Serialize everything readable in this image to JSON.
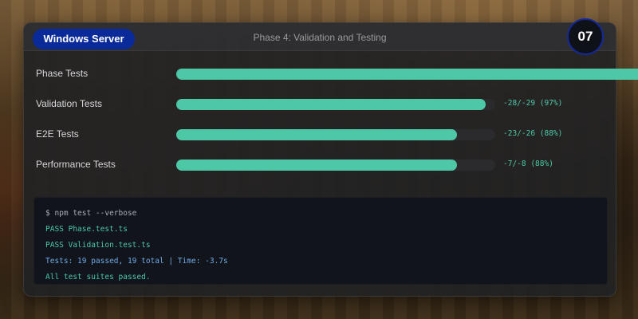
{
  "header": {
    "os_badge": "Windows Server",
    "phase_title": "Phase 4: Validation and Testing",
    "step_number": "07"
  },
  "tests": [
    {
      "label": "Phase Tests",
      "stat": "",
      "progress": 1.45
    },
    {
      "label": "Validation Tests",
      "stat": "-28/-29 (97%)",
      "progress": 0.97
    },
    {
      "label": "E2E Tests",
      "stat": "-23/-26 (88%)",
      "progress": 0.88
    },
    {
      "label": "Performance Tests",
      "stat": "-7/-8 (88%)",
      "progress": 0.88
    }
  ],
  "terminal": {
    "command": "$ npm test --verbose",
    "pass_1": "PASS Phase.test.ts",
    "pass_2": "PASS Validation.test.ts",
    "summary": "Tests: 19 passed, 19 total | Time: -3.7s",
    "result": "All test suites passed."
  },
  "colors": {
    "accent": "#4cc8a7",
    "badge": "#0b2a9a",
    "panel": "#222224",
    "summary_text": "#6fa9e6"
  }
}
